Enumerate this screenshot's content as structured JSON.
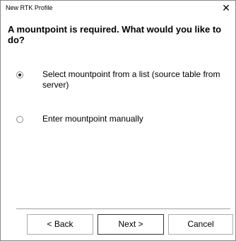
{
  "window": {
    "title": "New RTK Profile",
    "close_glyph": "✕"
  },
  "heading": "A mountpoint is required. What would you like to do?",
  "options": [
    {
      "label": "Select mountpoint from a list (source table from server)",
      "selected": true
    },
    {
      "label": "Enter mountpoint manually",
      "selected": false
    }
  ],
  "buttons": {
    "back": "< Back",
    "next": "Next >",
    "cancel": "Cancel"
  }
}
